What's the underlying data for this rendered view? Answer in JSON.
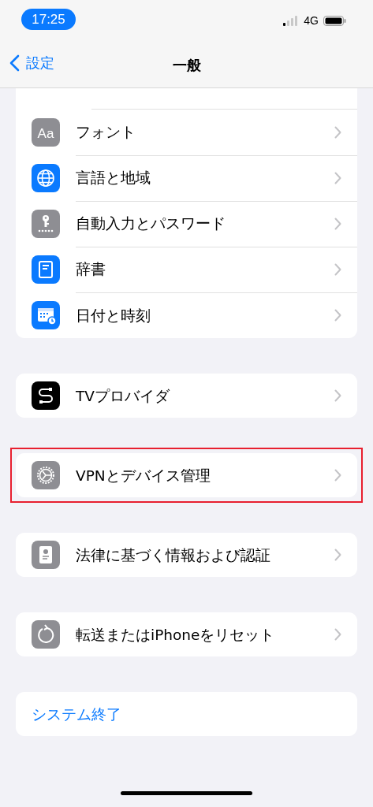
{
  "status_bar": {
    "time": "17:25",
    "network": "4G"
  },
  "nav": {
    "back": "設定",
    "title": "一般"
  },
  "groups": [
    {
      "rows": [
        {
          "label": "フォント",
          "kind": "font",
          "icon_text": "Aa"
        },
        {
          "label": "言語と地域",
          "kind": "globe"
        },
        {
          "label": "自動入力とパスワード",
          "kind": "key"
        },
        {
          "label": "辞書",
          "kind": "book"
        },
        {
          "label": "日付と時刻",
          "kind": "calendar"
        }
      ]
    },
    {
      "rows": [
        {
          "label": "TVプロバイダ",
          "kind": "cable"
        }
      ]
    },
    {
      "rows": [
        {
          "label": "VPNとデバイス管理",
          "kind": "gear",
          "highlighted": true
        }
      ]
    },
    {
      "rows": [
        {
          "label": "法律に基づく情報および認証",
          "kind": "certificate"
        }
      ]
    },
    {
      "rows": [
        {
          "label": "転送またはiPhoneをリセット",
          "kind": "reset"
        }
      ]
    },
    {
      "rows": [
        {
          "label": "システム終了",
          "kind": "action"
        }
      ]
    }
  ]
}
